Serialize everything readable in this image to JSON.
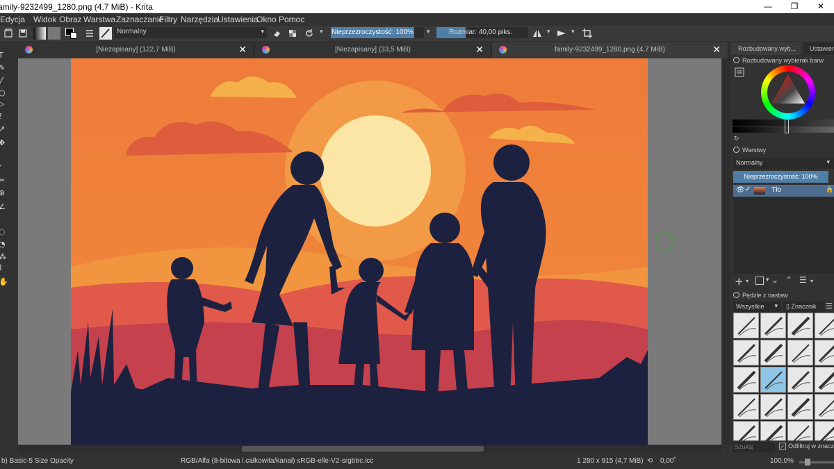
{
  "window": {
    "title": "amily-9232499_1280.png (4,7 MiB)  - Krita",
    "minimize": "—",
    "maximize": "❐",
    "close": "✕"
  },
  "menu": [
    "Edycja",
    "Widok",
    "Obraz",
    "Warstwa",
    "Zaznaczanie",
    "Filtry",
    "Narzędzia",
    "Ustawienia",
    "Okno",
    "Pomoc"
  ],
  "toolbar": {
    "blend_mode": "Normalny",
    "opacity": "Nieprzezroczystość: 100%",
    "size": "Rozmiar: 40,00 piks.",
    "size_fraction": 0.32
  },
  "tabs": [
    {
      "label": "[Niezapisany]  (122,7 MiB)",
      "close": "✕"
    },
    {
      "label": "[Niezapisany]  (33,5 MiB)",
      "close": "✕"
    },
    {
      "label": "family-9232499_1280.png (4,7 MiB)",
      "close": "✕"
    }
  ],
  "dockers": {
    "tabs": [
      "Rozbudowany wyb...",
      "Ustawien"
    ],
    "color_selector_title": "Rozbudowany wybierak barw",
    "layers_title": "Warstwy",
    "layer_blend": "Normalny",
    "layer_opacity": "Nieprzezroczystość:  100%",
    "layer_name": "Tło",
    "brushes_title": "Pędzle z nastaw",
    "brush_filter": "Wszystkie",
    "brush_tag": "Znacznik",
    "search_placeholder": "Szukaj",
    "filter_label": "Odfiltruj w znacz"
  },
  "status": {
    "brush": "b) Basic-5 Size Opacity",
    "color_space": "RGB/Alfa (8-bitowa l.całkowita/kanał)  sRGB-elle-V2-srgbtrc.icc",
    "image_size": "1 280 x 915 (4,7 MiB)",
    "rotation": "0,00˚",
    "zoom": "100,0%"
  },
  "colors": {
    "accent": "#4f7ea6",
    "panel": "#323232",
    "sky_top": "#ef7c3a",
    "sun": "#fbe6a6",
    "silhouette": "#1c2140"
  }
}
